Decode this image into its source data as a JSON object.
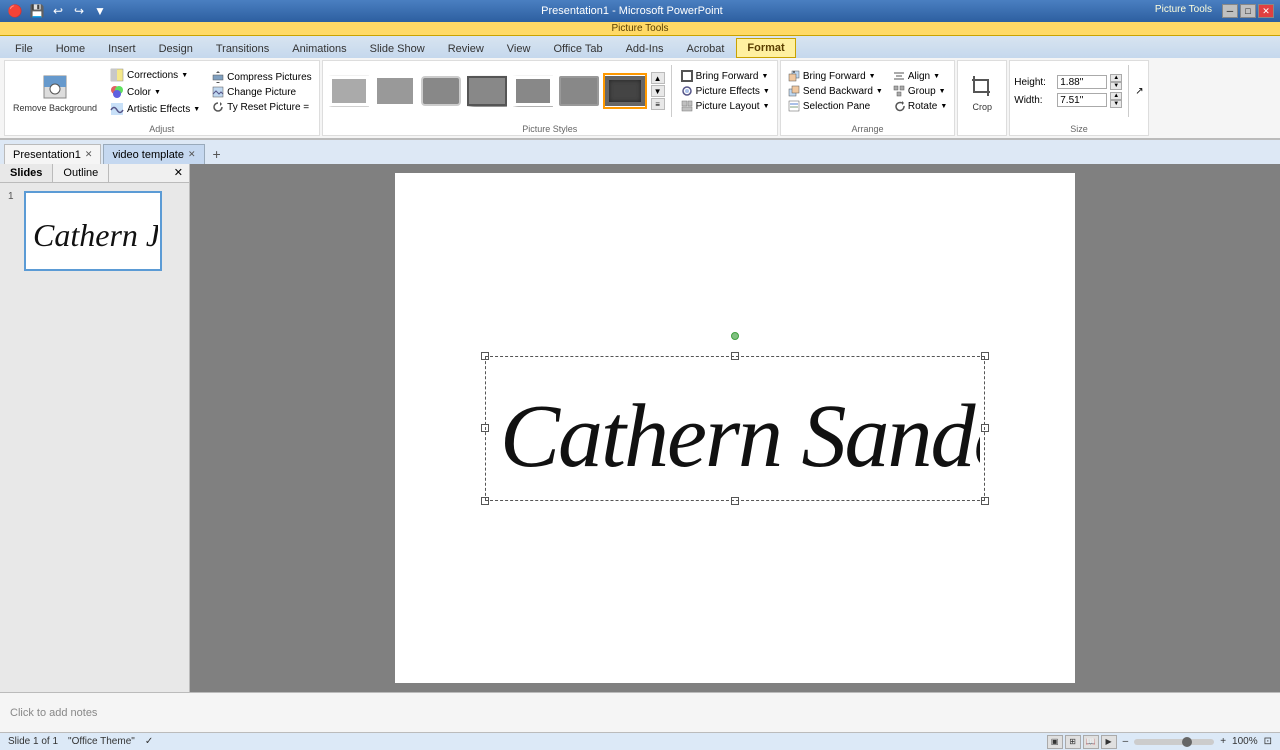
{
  "titlebar": {
    "title": "Presentation1 - Microsoft PowerPoint",
    "contextual_label": "Picture Tools"
  },
  "quick_access": {
    "save": "💾",
    "undo": "↩",
    "redo": "↪",
    "dropdown": "▼"
  },
  "ribbon_tabs": [
    {
      "label": "File",
      "active": false
    },
    {
      "label": "Home",
      "active": false
    },
    {
      "label": "Insert",
      "active": false
    },
    {
      "label": "Design",
      "active": false
    },
    {
      "label": "Transitions",
      "active": false
    },
    {
      "label": "Animations",
      "active": false
    },
    {
      "label": "Slide Show",
      "active": false
    },
    {
      "label": "Review",
      "active": false
    },
    {
      "label": "View",
      "active": false
    },
    {
      "label": "Office Tab",
      "active": false
    },
    {
      "label": "Add-Ins",
      "active": false
    },
    {
      "label": "Acrobat",
      "active": false
    },
    {
      "label": "Format",
      "active": true,
      "contextual": true
    }
  ],
  "adjust_group": {
    "label": "Adjust",
    "remove_bg": "Remove Background",
    "corrections": "Corrections",
    "color": "Color",
    "artistic": "Artistic Effects",
    "compress": "Compress Pictures",
    "change": "Change Picture",
    "reset": "Reset Picture",
    "reset_label": "Ty Reset Picture ="
  },
  "picture_styles": {
    "label": "Picture Styles",
    "items": [
      {
        "id": "s1",
        "label": "Simple Frame, White"
      },
      {
        "id": "s2",
        "label": "Simple Frame, Black"
      },
      {
        "id": "s3",
        "label": "Rounded Diagonal Corner"
      },
      {
        "id": "s4",
        "label": "Drop Shadow"
      },
      {
        "id": "s5",
        "label": "Reflected Bevel"
      },
      {
        "id": "s6",
        "label": "Metal Frame"
      },
      {
        "id": "s7",
        "label": "Center Shadow Rectangle"
      }
    ]
  },
  "arrange_group": {
    "label": "Arrange",
    "bring_forward": "Bring Forward",
    "send_backward": "Send Backward",
    "selection_pane": "Selection Pane",
    "align": "Align",
    "group": "Group",
    "rotate": "Rotate"
  },
  "crop_group": {
    "label": "",
    "crop": "Crop"
  },
  "size_group": {
    "label": "Size",
    "height_label": "Height:",
    "height_value": "1.88\"",
    "width_label": "Width:",
    "width_value": "7.51\""
  },
  "doc_tabs": [
    {
      "label": "Presentation1",
      "active": true,
      "closable": true
    },
    {
      "label": "video template",
      "active": false,
      "closable": true
    }
  ],
  "slides_panel": {
    "tabs": [
      {
        "label": "Slides",
        "active": true
      },
      {
        "label": "Outline",
        "active": false
      }
    ],
    "slides": [
      {
        "number": "1",
        "has_signature": true
      }
    ]
  },
  "canvas": {
    "notes_placeholder": "Click to add notes",
    "signature_text": "Cathern Janders Reach"
  },
  "status_bar": {
    "slide_info": "Slide 1 of 1",
    "theme": "\"Office Theme\"",
    "zoom": "100%"
  }
}
